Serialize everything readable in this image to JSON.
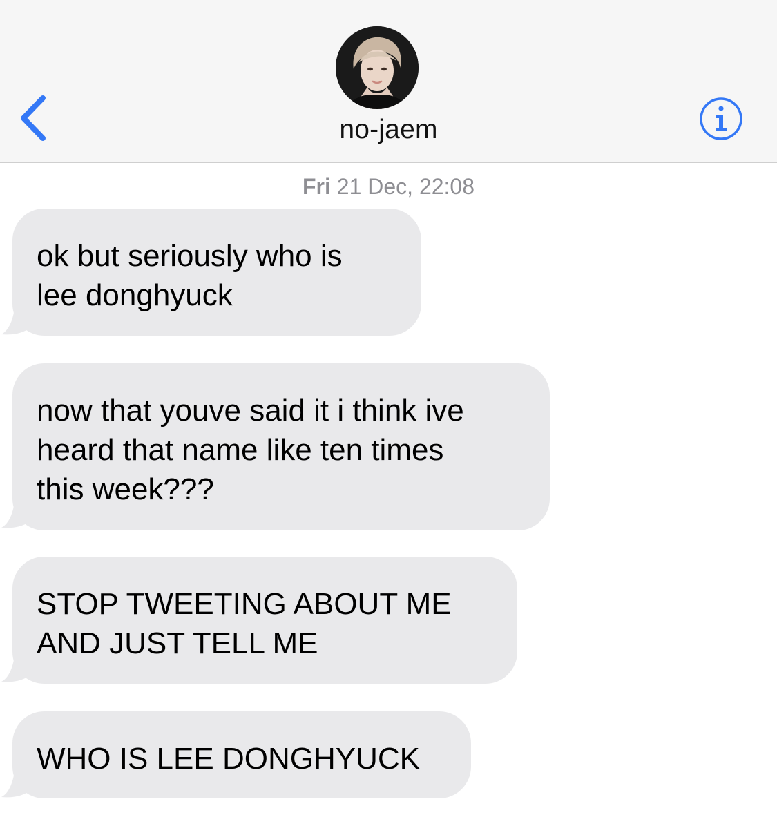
{
  "header": {
    "contact_name": "no-jaem",
    "back_icon": "chevron-left-icon",
    "info_icon": "info-circle-icon",
    "accent_color": "#3478f6"
  },
  "timestamp": {
    "day": "Fri",
    "rest": " 21 Dec, 22:08"
  },
  "messages": [
    {
      "lines": [
        "ok but seriously who is",
        "lee donghyuck"
      ]
    },
    {
      "lines": [
        "now that youve said it i think ive",
        "heard that name like ten times",
        "this week???"
      ]
    },
    {
      "lines": [
        "STOP TWEETING ABOUT ME",
        "AND JUST TELL ME"
      ]
    },
    {
      "lines": [
        "WHO IS LEE DONGHYUCK"
      ]
    }
  ],
  "colors": {
    "header_bg": "#f6f6f6",
    "bubble_bg": "#e9e9eb",
    "timestamp": "#8e8e93"
  }
}
